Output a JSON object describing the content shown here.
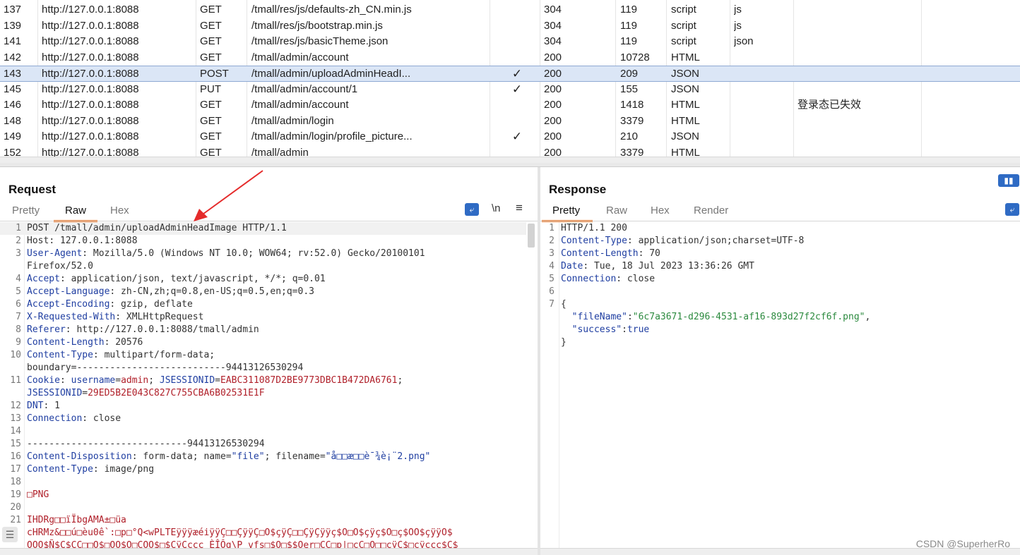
{
  "history": {
    "rows": [
      {
        "id": "137",
        "host": "http://127.0.0.1:8088",
        "method": "GET",
        "url": "/tmall/res/js/defaults-zh_CN.min.js",
        "edited": "",
        "status": "304",
        "length": "119",
        "mime": "script",
        "ext": "js",
        "title": ""
      },
      {
        "id": "139",
        "host": "http://127.0.0.1:8088",
        "method": "GET",
        "url": "/tmall/res/js/bootstrap.min.js",
        "edited": "",
        "status": "304",
        "length": "119",
        "mime": "script",
        "ext": "js",
        "title": ""
      },
      {
        "id": "141",
        "host": "http://127.0.0.1:8088",
        "method": "GET",
        "url": "/tmall/res/js/basicTheme.json",
        "edited": "",
        "status": "304",
        "length": "119",
        "mime": "script",
        "ext": "json",
        "title": ""
      },
      {
        "id": "142",
        "host": "http://127.0.0.1:8088",
        "method": "GET",
        "url": "/tmall/admin/account",
        "edited": "",
        "status": "200",
        "length": "10728",
        "mime": "HTML",
        "ext": "",
        "title": ""
      },
      {
        "id": "143",
        "host": "http://127.0.0.1:8088",
        "method": "POST",
        "url": "/tmall/admin/uploadAdminHeadI...",
        "edited": "✓",
        "status": "200",
        "length": "209",
        "mime": "JSON",
        "ext": "",
        "title": "",
        "selected": true
      },
      {
        "id": "145",
        "host": "http://127.0.0.1:8088",
        "method": "PUT",
        "url": "/tmall/admin/account/1",
        "edited": "✓",
        "status": "200",
        "length": "155",
        "mime": "JSON",
        "ext": "",
        "title": ""
      },
      {
        "id": "146",
        "host": "http://127.0.0.1:8088",
        "method": "GET",
        "url": "/tmall/admin/account",
        "edited": "",
        "status": "200",
        "length": "1418",
        "mime": "HTML",
        "ext": "",
        "title": "登录态已失效"
      },
      {
        "id": "148",
        "host": "http://127.0.0.1:8088",
        "method": "GET",
        "url": "/tmall/admin/login",
        "edited": "",
        "status": "200",
        "length": "3379",
        "mime": "HTML",
        "ext": "",
        "title": ""
      },
      {
        "id": "149",
        "host": "http://127.0.0.1:8088",
        "method": "GET",
        "url": "/tmall/admin/login/profile_picture...",
        "edited": "✓",
        "status": "200",
        "length": "210",
        "mime": "JSON",
        "ext": "",
        "title": ""
      },
      {
        "id": "152",
        "host": "http://127.0.0.1:8088",
        "method": "GET",
        "url": "/tmall/admin",
        "edited": "",
        "status": "200",
        "length": "3379",
        "mime": "HTML",
        "ext": "",
        "title": ""
      }
    ]
  },
  "request": {
    "title": "Request",
    "tabs": [
      "Pretty",
      "Raw",
      "Hex"
    ],
    "active_tab": "Raw",
    "newline_toggle": "\\n",
    "menu_icon": "hamburger-icon",
    "wrap_icon": "wrap-lines-icon",
    "lines": [
      {
        "n": "1",
        "segs": [
          [
            "POST /tmall/admin/uploadAdminHeadImage HTTP/1.1",
            ""
          ]
        ]
      },
      {
        "n": "2",
        "segs": [
          [
            "Host",
            ""
          ],
          [
            ": 127.0.0.1:8088",
            ""
          ]
        ]
      },
      {
        "n": "3",
        "segs": [
          [
            "User-Agent",
            "hk"
          ],
          [
            ": Mozilla/5.0 (Windows NT 10.0; WOW64; rv:52.0) Gecko/20100101",
            ""
          ]
        ]
      },
      {
        "n": "",
        "segs": [
          [
            "Firefox/52.0",
            ""
          ]
        ]
      },
      {
        "n": "4",
        "segs": [
          [
            "Accept",
            "hk"
          ],
          [
            ": application/json, text/javascript, */*; q=0.01",
            ""
          ]
        ]
      },
      {
        "n": "5",
        "segs": [
          [
            "Accept-Language",
            "hk"
          ],
          [
            ": zh-CN,zh;q=0.8,en-US;q=0.5,en;q=0.3",
            ""
          ]
        ]
      },
      {
        "n": "6",
        "segs": [
          [
            "Accept-Encoding",
            "hk"
          ],
          [
            ": gzip, deflate",
            ""
          ]
        ]
      },
      {
        "n": "7",
        "segs": [
          [
            "X-Requested-With",
            "hk"
          ],
          [
            ": XMLHttpRequest",
            ""
          ]
        ]
      },
      {
        "n": "8",
        "segs": [
          [
            "Referer",
            "hk"
          ],
          [
            ": http://127.0.0.1:8088/tmall/admin",
            ""
          ]
        ]
      },
      {
        "n": "9",
        "segs": [
          [
            "Content-Length",
            "hk"
          ],
          [
            ": 20576",
            ""
          ]
        ]
      },
      {
        "n": "10",
        "segs": [
          [
            "Content-Type",
            "hk"
          ],
          [
            ": multipart/form-data;",
            ""
          ]
        ]
      },
      {
        "n": "",
        "segs": [
          [
            "boundary=---------------------------94413126530294",
            ""
          ]
        ]
      },
      {
        "n": "11",
        "segs": [
          [
            "Cookie",
            "hk"
          ],
          [
            ": ",
            ""
          ],
          [
            "username",
            "blu"
          ],
          [
            "=",
            ""
          ],
          [
            "admin",
            "red"
          ],
          [
            "; ",
            ""
          ],
          [
            "JSESSIONID",
            "blu"
          ],
          [
            "=",
            ""
          ],
          [
            "EABC311087D2BE9773DBC1B472DA6761",
            "red"
          ],
          [
            ";",
            ""
          ]
        ]
      },
      {
        "n": "",
        "segs": [
          [
            "JSESSIONID",
            "blu"
          ],
          [
            "=",
            ""
          ],
          [
            "29ED5B2E043C827C755CBA6B02531E1F",
            "red"
          ]
        ]
      },
      {
        "n": "12",
        "segs": [
          [
            "DNT",
            "hk"
          ],
          [
            ": 1",
            ""
          ]
        ]
      },
      {
        "n": "13",
        "segs": [
          [
            "Connection",
            "hk"
          ],
          [
            ": close",
            ""
          ]
        ]
      },
      {
        "n": "14",
        "segs": [
          [
            "",
            ""
          ]
        ]
      },
      {
        "n": "15",
        "segs": [
          [
            "-----------------------------94413126530294",
            ""
          ]
        ]
      },
      {
        "n": "16",
        "segs": [
          [
            "Content-Disposition",
            "hk"
          ],
          [
            ": form-data; name=",
            ""
          ],
          [
            "\"file\"",
            "blu"
          ],
          [
            "; filename=",
            ""
          ],
          [
            "\"å□□æ□□è¯¾è¡¨2.png\"",
            "blu"
          ]
        ]
      },
      {
        "n": "17",
        "segs": [
          [
            "Content-Type",
            "hk"
          ],
          [
            ": image/png",
            ""
          ]
        ]
      },
      {
        "n": "18",
        "segs": [
          [
            "",
            ""
          ]
        ]
      },
      {
        "n": "19",
        "segs": [
          [
            "□PNG",
            "red"
          ]
        ]
      },
      {
        "n": "20",
        "segs": [
          [
            "",
            ""
          ]
        ]
      },
      {
        "n": "21",
        "segs": [
          [
            "IHDRg□□ïÏbgAMA±□üa",
            "red"
          ]
        ]
      },
      {
        "n": "",
        "segs": [
          [
            "cHRMz&□□ú□èu0ê`:□p□°Q<wPLTEÿÿÿæéiÿÿÇ□□ÇÿÿÇ□O$çÿÇ□□ÇÿÇÿÿç$O□O$çÿç$O□ç$OO$çÿÿO$",
            "red"
          ]
        ]
      },
      {
        "n": "",
        "segs": [
          [
            "OOO$Ñ$Ç$ÇÇ□□O$□OO$O□COO$□$CÿCccc ÈÎÔg\\P vfs□$O□$$Oer□CC□p|□cC□O□□cÿC$□cÿccc$C$",
            "red"
          ]
        ]
      }
    ]
  },
  "response": {
    "title": "Response",
    "tabs": [
      "Pretty",
      "Raw",
      "Hex",
      "Render"
    ],
    "active_tab": "Pretty",
    "lines": [
      {
        "n": "1",
        "segs": [
          [
            "HTTP/1.1 200",
            ""
          ]
        ]
      },
      {
        "n": "2",
        "segs": [
          [
            "Content-Type",
            "hk"
          ],
          [
            ": application/json;charset=UTF-8",
            ""
          ]
        ]
      },
      {
        "n": "3",
        "segs": [
          [
            "Content-Length",
            "hk"
          ],
          [
            ": 70",
            ""
          ]
        ]
      },
      {
        "n": "4",
        "segs": [
          [
            "Date",
            "hk"
          ],
          [
            ": Tue, 18 Jul 2023 13:36:26 GMT",
            ""
          ]
        ]
      },
      {
        "n": "5",
        "segs": [
          [
            "Connection",
            "hk"
          ],
          [
            ": close",
            ""
          ]
        ]
      },
      {
        "n": "6",
        "segs": [
          [
            "",
            ""
          ]
        ]
      },
      {
        "n": "7",
        "segs": [
          [
            "{",
            ""
          ]
        ]
      },
      {
        "n": "",
        "segs": [
          [
            "  ",
            ""
          ],
          [
            "\"fileName\"",
            "hk"
          ],
          [
            ":",
            ""
          ],
          [
            "\"6c7a3671-d296-4531-af16-893d27f2cf6f.png\"",
            "str"
          ],
          [
            ",",
            ""
          ]
        ]
      },
      {
        "n": "",
        "segs": [
          [
            "  ",
            ""
          ],
          [
            "\"success\"",
            "hk"
          ],
          [
            ":",
            ""
          ],
          [
            "true",
            "hk"
          ]
        ]
      },
      {
        "n": "",
        "segs": [
          [
            "}",
            ""
          ]
        ]
      }
    ]
  },
  "watermark": "CSDN @SuperherRo"
}
